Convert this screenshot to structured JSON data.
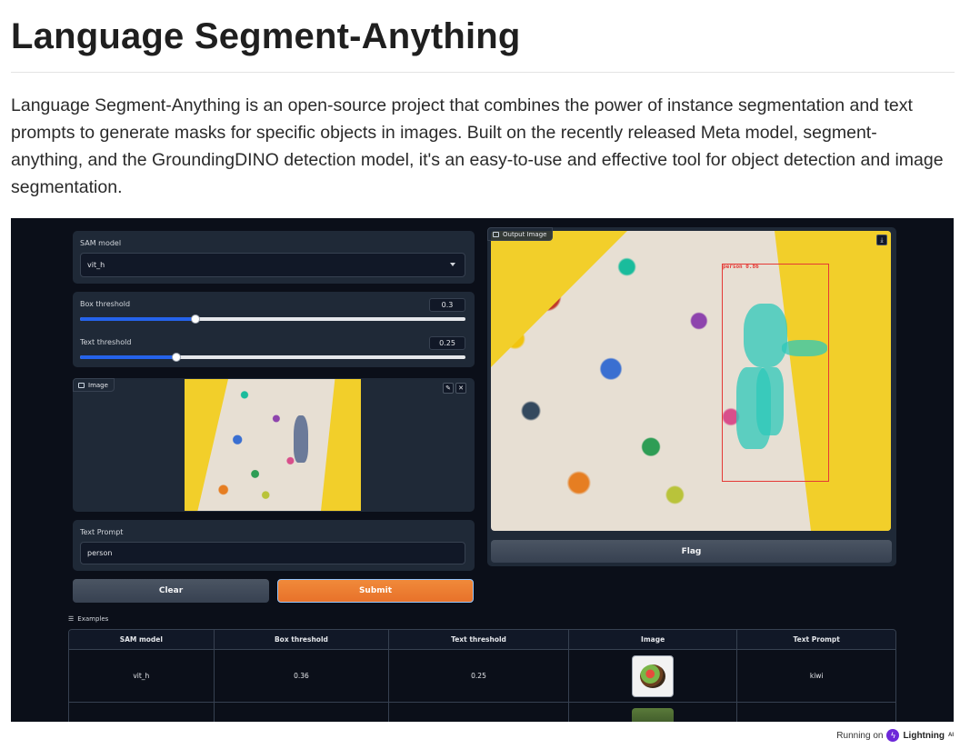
{
  "page": {
    "title": "Language Segment-Anything",
    "intro": "Language Segment-Anything is an open-source project that combines the power of instance segmentation and text prompts to generate masks for specific objects in images. Built on the recently released Meta model, segment-anything, and the GroundingDINO detection model, it's an easy-to-use and effective tool for object detection and image segmentation."
  },
  "inputs": {
    "sam_model": {
      "label": "SAM model",
      "value": "vit_h"
    },
    "box_threshold": {
      "label": "Box threshold",
      "value": "0.3",
      "fraction": 0.3
    },
    "text_threshold": {
      "label": "Text threshold",
      "value": "0.25",
      "fraction": 0.25
    },
    "image": {
      "label": "Image"
    },
    "text_prompt": {
      "label": "Text Prompt",
      "value": "person"
    }
  },
  "buttons": {
    "clear": "Clear",
    "submit": "Submit",
    "flag": "Flag"
  },
  "output": {
    "label": "Output Image",
    "detection_label": "person 0.86"
  },
  "examples": {
    "title": "Examples",
    "columns": [
      "SAM model",
      "Box threshold",
      "Text threshold",
      "Image",
      "Text Prompt"
    ],
    "rows": [
      {
        "sam_model": "vit_h",
        "box_threshold": "0.36",
        "text_threshold": "0.25",
        "text_prompt": "kiwi"
      }
    ]
  },
  "footer": {
    "running_on": "Running on",
    "brand": "Lightning",
    "brand_suffix": "AI"
  },
  "colors": {
    "app_bg": "#0b0f19",
    "panel": "#1f2937",
    "submit": "#e8722a",
    "slider": "#2563eb",
    "wall_yellow": "#f2cf2a"
  },
  "icons": [
    "image-icon",
    "edit-icon",
    "close-icon",
    "download-icon",
    "list-icon",
    "lightning-icon",
    "chevron-down-icon"
  ]
}
